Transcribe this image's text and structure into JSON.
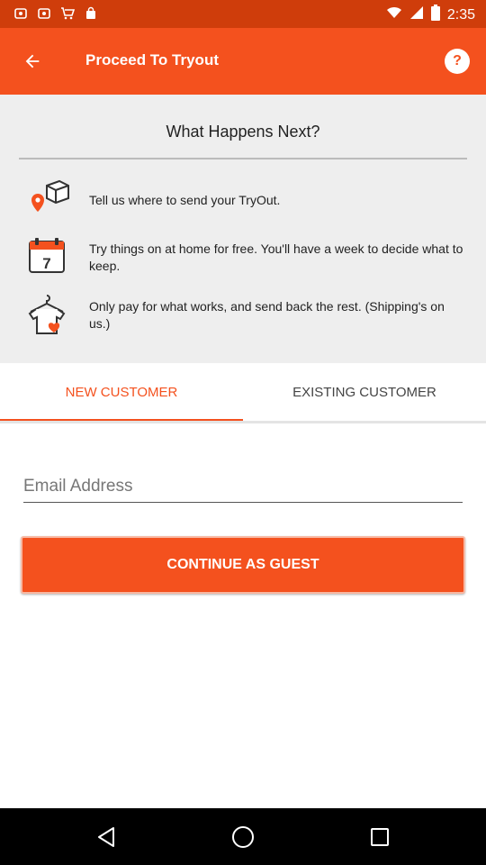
{
  "status_bar": {
    "time": "2:35",
    "icons": [
      "notification-icon",
      "notification-icon",
      "cart-icon",
      "shopping-bag-icon",
      "wifi-icon",
      "signal-icon",
      "battery-icon"
    ]
  },
  "app_bar": {
    "title": "Proceed To Tryout",
    "help_label": "?"
  },
  "info": {
    "heading": "What Happens Next?",
    "steps": [
      {
        "icon": "package-location-icon",
        "text": "Tell us where to send your TryOut."
      },
      {
        "icon": "calendar-icon",
        "text": "Try things on at home for free. You'll have a week to decide what to keep."
      },
      {
        "icon": "shirt-heart-icon",
        "text": "Only pay for what works, and send back the rest. (Shipping's on us.)"
      }
    ]
  },
  "tabs": [
    {
      "label": "NEW CUSTOMER",
      "active": true
    },
    {
      "label": "EXISTING CUSTOMER",
      "active": false
    }
  ],
  "form": {
    "email_placeholder": "Email Address",
    "email_value": "",
    "continue_label": "CONTINUE AS GUEST"
  },
  "colors": {
    "accent": "#f4511e",
    "status_bar": "#cf3d0b",
    "info_background": "#eeeeee",
    "icon_orange": "#f4511e",
    "icon_dark": "#333333"
  }
}
